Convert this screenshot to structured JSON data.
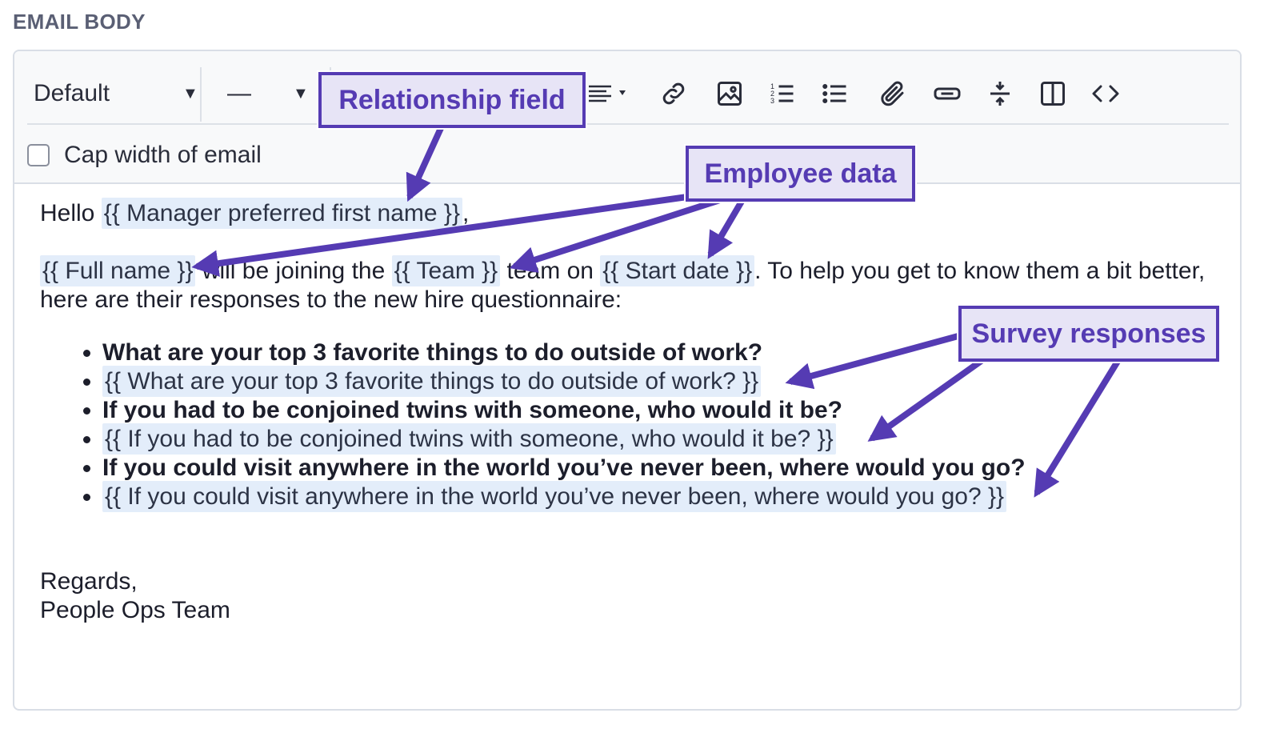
{
  "section_label": "EMAIL BODY",
  "toolbar": {
    "font_dropdown": "Default",
    "size_dropdown": "—",
    "icons": [
      "align-icon",
      "link-icon",
      "image-icon",
      "ordered-list-icon",
      "bullet-list-icon",
      "attachment-icon",
      "button-icon",
      "divider-icon",
      "columns-icon",
      "code-icon"
    ]
  },
  "cap_width_label": "Cap width of email",
  "body": {
    "greeting": "Hello",
    "manager_tag": "{{ Manager preferred first name }}",
    "greeting_punct": ",",
    "full_name_tag": "{{ Full name }}",
    "text_joining": " will be joining the ",
    "team_tag": "{{ Team }}",
    "text_team_on": " team on ",
    "start_date_tag": "{{ Start date }}",
    "text_rest": ". To help you get to know them a bit better, here are their responses to the new hire questionnaire:",
    "questions": [
      {
        "question": "What are your top 3 favorite things to do outside of work?",
        "answer_tag": "{{ What are your top 3 favorite things to do outside of work? }}"
      },
      {
        "question": "If you had to be conjoined twins with someone, who would it be?",
        "answer_tag": "{{ If you had to be conjoined twins with someone, who would it be? }}"
      },
      {
        "question": "If you could visit anywhere in the world you’ve never been, where would you go?",
        "answer_tag": "{{ If you could visit anywhere in the world you’ve never been, where would you go? }}"
      }
    ],
    "regards": "Regards,",
    "signature": "People Ops Team"
  },
  "callouts": {
    "relationship": "Relationship field",
    "employee": "Employee data",
    "survey": "Survey responses"
  },
  "colors": {
    "accent": "#553bb3",
    "callout_bg": "#e7e4f6",
    "tag_bg": "#e3edfa"
  }
}
